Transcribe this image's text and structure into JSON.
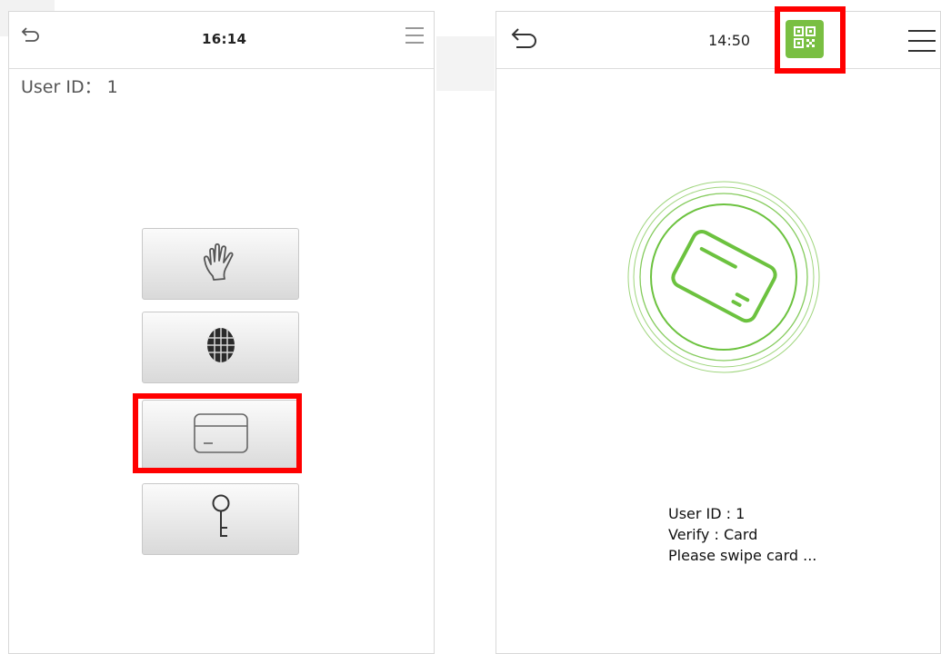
{
  "left_screen": {
    "time": "16:14",
    "user_id_label": "User ID： 1",
    "verify_buttons": [
      {
        "name": "palm",
        "icon": "palm-icon"
      },
      {
        "name": "face",
        "icon": "face-icon"
      },
      {
        "name": "card",
        "icon": "card-icon",
        "highlighted": true
      },
      {
        "name": "password",
        "icon": "key-icon"
      }
    ]
  },
  "right_screen": {
    "time": "14:50",
    "qr_icon": "qr-code-icon",
    "qr_highlighted": true,
    "status": {
      "user_id": "User ID : 1",
      "verify": "Verify : Card",
      "prompt": "Please swipe card ..."
    }
  },
  "colors": {
    "highlight": "#ff0000",
    "accent_green": "#79bf42",
    "card_green": "#6cc23f"
  }
}
